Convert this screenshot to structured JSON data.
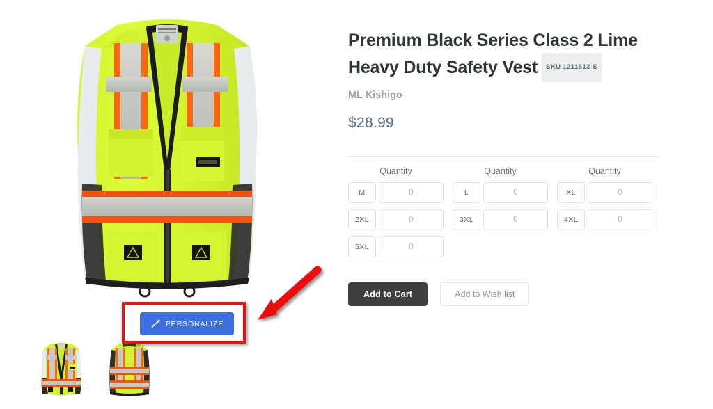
{
  "product": {
    "title": "Premium Black Series Class 2 Lime Heavy Duty Safety Vest",
    "sku_badge": "SKU 1211513-S",
    "brand": "ML Kishigo",
    "price": "$28.99"
  },
  "gallery": {
    "personalize_label": "PERSONALIZE",
    "personalize_icon": "paintbrush-icon",
    "highlight_color": "#ee1111",
    "personalize_button_color": "#3d6fe0",
    "annotation": "red-arrow-pointing-to-personalize-button",
    "main_image_alt": "Lime hi-vis safety vest front view",
    "thumbnails": [
      {
        "alt": "Safety vest front view"
      },
      {
        "alt": "Safety vest back view"
      }
    ]
  },
  "quantity": {
    "heading": "Quantity",
    "columns": [
      {
        "heading": "Quantity",
        "rows": [
          {
            "size": "M",
            "value": "0"
          },
          {
            "size": "2XL",
            "value": "0"
          },
          {
            "size": "5XL",
            "value": "0"
          }
        ]
      },
      {
        "heading": "Quantity",
        "rows": [
          {
            "size": "L",
            "value": "0"
          },
          {
            "size": "3XL",
            "value": "0"
          }
        ]
      },
      {
        "heading": "Quantity",
        "rows": [
          {
            "size": "XL",
            "value": "0"
          },
          {
            "size": "4XL",
            "value": "0"
          }
        ]
      }
    ]
  },
  "actions": {
    "add_to_cart": "Add to Cart",
    "add_to_wishlist": "Add to Wish list",
    "cart_color": "#3f3f3f"
  }
}
